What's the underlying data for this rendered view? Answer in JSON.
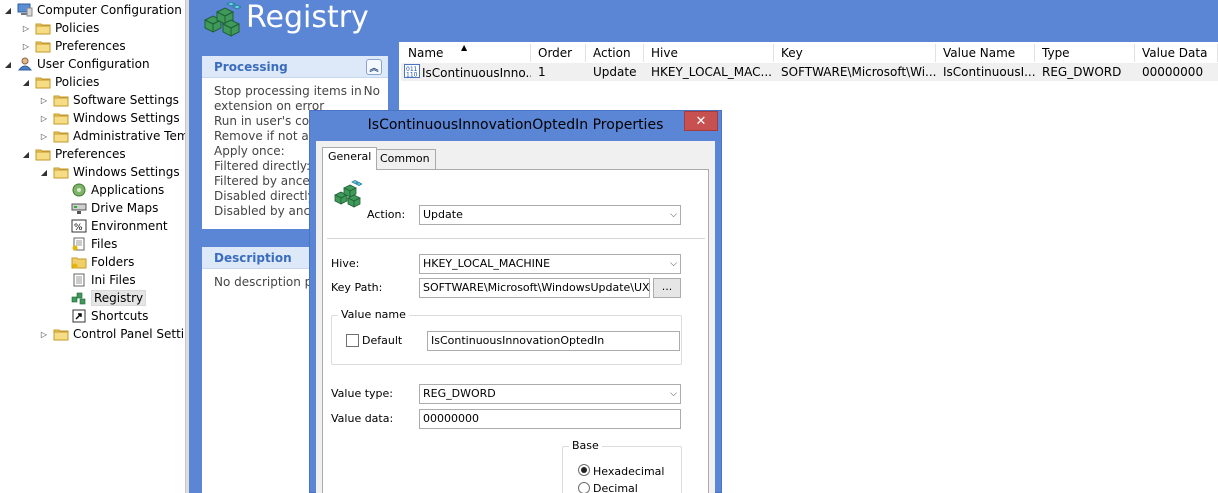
{
  "tree": {
    "items": [
      {
        "label": "Computer Configuration",
        "expander": "◢",
        "icon": "computer-icon"
      },
      {
        "label": "Policies",
        "expander": "▷",
        "icon": "folder-icon"
      },
      {
        "label": "Preferences",
        "expander": "▷",
        "icon": "folder-icon"
      },
      {
        "label": "User Configuration",
        "expander": "◢",
        "icon": "user-icon"
      },
      {
        "label": "Policies",
        "expander": "◢",
        "icon": "folder-icon"
      },
      {
        "label": "Software Settings",
        "expander": "▷",
        "icon": "folder-icon"
      },
      {
        "label": "Windows Settings",
        "expander": "▷",
        "icon": "folder-icon"
      },
      {
        "label": "Administrative Temp",
        "expander": "▷",
        "icon": "folder-icon"
      },
      {
        "label": "Preferences",
        "expander": "◢",
        "icon": "folder-icon"
      },
      {
        "label": "Windows Settings",
        "expander": "◢",
        "icon": "folder-icon"
      },
      {
        "label": "Applications",
        "expander": "",
        "icon": "applications-icon"
      },
      {
        "label": "Drive Maps",
        "expander": "",
        "icon": "drive-maps-icon"
      },
      {
        "label": "Environment",
        "expander": "",
        "icon": "environment-icon"
      },
      {
        "label": "Files",
        "expander": "",
        "icon": "files-icon"
      },
      {
        "label": "Folders",
        "expander": "",
        "icon": "folders-icon"
      },
      {
        "label": "Ini Files",
        "expander": "",
        "icon": "ini-files-icon"
      },
      {
        "label": "Registry",
        "expander": "",
        "icon": "registry-icon"
      },
      {
        "label": "Shortcuts",
        "expander": "",
        "icon": "shortcuts-icon"
      },
      {
        "label": "Control Panel Setting",
        "expander": "▷",
        "icon": "folder-icon"
      }
    ]
  },
  "banner": {
    "title": "Registry"
  },
  "processing": {
    "header": "Processing",
    "lines": [
      {
        "text": "Stop processing items in",
        "value": "No"
      },
      {
        "text": "extension on error",
        "value": ""
      },
      {
        "text": "Run in user's cont",
        "value": ""
      },
      {
        "text": "Remove if not app",
        "value": ""
      },
      {
        "text": "Apply once:",
        "value": ""
      },
      {
        "text": "Filtered directly:",
        "value": ""
      },
      {
        "text": "Filtered by ancest",
        "value": ""
      },
      {
        "text": "Disabled directly:",
        "value": ""
      },
      {
        "text": "Disabled by ances",
        "value": ""
      }
    ]
  },
  "description": {
    "header": "Description",
    "text": "No description pr"
  },
  "list": {
    "columns": [
      "Name",
      "Order",
      "Action",
      "Hive",
      "Key",
      "Value Name",
      "Type",
      "Value Data"
    ],
    "sort_arrow": "▲",
    "rows": [
      [
        "IsContinuousInno...",
        "1",
        "Update",
        "HKEY_LOCAL_MAC...",
        "SOFTWARE\\Microsoft\\Wi...",
        "IsContinuousI...",
        "REG_DWORD",
        "00000000"
      ]
    ]
  },
  "dialog": {
    "title": "IsContinuousInnovationOptedIn Properties",
    "close_label": "✕",
    "tabs": [
      "General",
      "Common"
    ],
    "action_label": "Action:",
    "action_value": "Update",
    "hive_label": "Hive:",
    "hive_value": "HKEY_LOCAL_MACHINE",
    "keypath_label": "Key Path:",
    "keypath_value": "SOFTWARE\\Microsoft\\WindowsUpdate\\UX\\Settings",
    "browse_label": "...",
    "valuename_group": "Value name",
    "default_label": "Default",
    "valuename_value": "IsContinuousInnovationOptedIn",
    "valuetype_label": "Value type:",
    "valuetype_value": "REG_DWORD",
    "valuedata_label": "Value data:",
    "valuedata_value": "00000000",
    "base_group": "Base",
    "hex_label": "Hexadecimal",
    "dec_label": "Decimal"
  }
}
